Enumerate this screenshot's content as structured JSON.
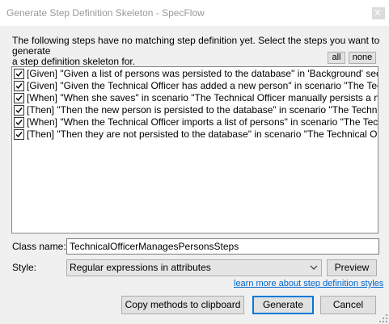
{
  "window": {
    "title": "Generate Step Definition Skeleton - SpecFlow"
  },
  "instructions": "The following steps have no matching step definition yet. Select the steps you want to generate\na step definition skeleton for.",
  "selection_buttons": {
    "all_label": "all",
    "none_label": "none"
  },
  "steps": [
    {
      "checked": true,
      "label": "[Given] \"Given a list of persons was persisted to the database\" in 'Background' section"
    },
    {
      "checked": true,
      "label": "[Given] \"Given the Technical Officer has added a new person\" in scenario \"The Technical O"
    },
    {
      "checked": true,
      "label": "[When] \"When she saves\" in scenario \"The Technical Officer manually persists a new perso"
    },
    {
      "checked": true,
      "label": "[Then] \"Then the new person is persisted to the database\" in scenario \"The Technical Offic"
    },
    {
      "checked": true,
      "label": "[When] \"When the Technical Officer imports a list of persons\" in scenario \"The Technical O"
    },
    {
      "checked": true,
      "label": "[Then] \"Then they are not persisted to the database\" in scenario \"The Technical Officer imp"
    }
  ],
  "class_name": {
    "label": "Class name:",
    "value": "TechnicalOfficerManagesPersonsSteps"
  },
  "style": {
    "label": "Style:",
    "selected": "Regular expressions in attributes",
    "preview_label": "Preview",
    "learn_more_link": "learn more about step definition styles"
  },
  "footer": {
    "copy_label": "Copy methods to clipboard",
    "generate_label": "Generate",
    "cancel_label": "Cancel"
  },
  "colors": {
    "link": "#0066cc",
    "default_button_border": "#0078d7",
    "title_text": "#999999"
  }
}
